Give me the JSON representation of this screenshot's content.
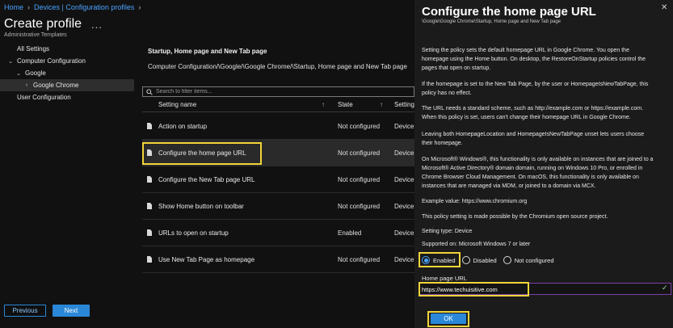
{
  "breadcrumb": [
    "Home",
    "Devices | Configuration profiles"
  ],
  "page": {
    "title": "Create profile",
    "more": "...",
    "subtitle": "Administrative Templates"
  },
  "tree": [
    {
      "label": "All Settings",
      "chevron": "",
      "indent": 0,
      "selected": false
    },
    {
      "label": "Computer Configuration",
      "chevron": "⌄",
      "indent": 0,
      "selected": false
    },
    {
      "label": "Google",
      "chevron": "⌄",
      "indent": 1,
      "selected": false
    },
    {
      "label": "Google Chrome",
      "chevron": "›",
      "indent": 2,
      "selected": true
    },
    {
      "label": "User Configuration",
      "chevron": "",
      "indent": 0,
      "selected": false
    }
  ],
  "buttons": {
    "previous": "Previous",
    "next": "Next",
    "ok": "OK"
  },
  "middle": {
    "heading": "Startup, Home page and New Tab page",
    "path": "Computer Configuration/\\Google/\\Google Chrome/\\Startup, Home page and New Tab page",
    "search_placeholder": "Search to filter items...",
    "columns": {
      "name": "Setting name",
      "state": "State",
      "type": "Setting"
    },
    "rows": [
      {
        "name": "Action on startup",
        "state": "Not configured",
        "type": "Device"
      },
      {
        "name": "Configure the home page URL",
        "state": "Not configured",
        "type": "Device"
      },
      {
        "name": "Configure the New Tab page URL",
        "state": "Not configured",
        "type": "Device"
      },
      {
        "name": "Show Home button on toolbar",
        "state": "Not configured",
        "type": "Device"
      },
      {
        "name": "URLs to open on startup",
        "state": "Enabled",
        "type": "Device"
      },
      {
        "name": "Use New Tab Page as homepage",
        "state": "Not configured",
        "type": "Device"
      }
    ],
    "selected_row": 1
  },
  "flyout": {
    "title": "Configure the home page URL",
    "path": "\\Google\\Google Chrome\\Startup, Home page and New Tab page",
    "paragraphs": [
      "Setting the policy sets the default homepage URL in Google Chrome. You open the homepage using the Home button. On desktop, the RestoreOnStartup policies control the pages that open on startup.",
      "If the homepage is set to the New Tab Page, by the user or HomepageIsNewTabPage, this policy has no effect.",
      " The URL needs a standard scheme, such as http://example.com or https://example.com. When this policy is set, users can't change their homepage URL in Google Chrome.",
      "Leaving both HomepageLocation and HomepageIsNewTabPage unset lets users choose their homepage.",
      "On Microsoft® Windows®, this functionality is only available on instances that are joined to a Microsoft® Active Directory® domain domain, running on Windows 10 Pro, or enrolled in Chrome Browser Cloud Management. On macOS, this functionality is only available on instances that are managed via MDM, or joined to a domain via MCX.",
      "Example value: https://www.chromium.org",
      "This policy setting is made possible by the Chromium open source project.",
      "Setting type: Device",
      "Supported on: Microsoft Windows 7 or later"
    ],
    "options": [
      "Enabled",
      "Disabled",
      "Not configured"
    ],
    "selected_option": "Enabled",
    "url_label": "Home page URL",
    "url_value": "https://www.techuisitive.com"
  },
  "colors": {
    "accent": "#2b88d8",
    "highlight": "#f2d43a",
    "link": "#4aa3ff"
  }
}
